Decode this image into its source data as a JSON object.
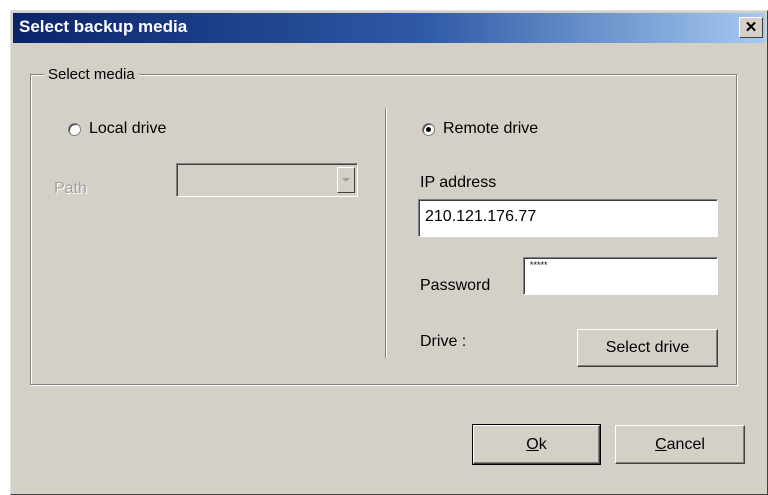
{
  "window": {
    "title": "Select backup media",
    "close_glyph": "✕"
  },
  "group": {
    "label": "Select media"
  },
  "local": {
    "radio_label": "Local drive",
    "selected": false,
    "path_label": "Path",
    "path_value": ""
  },
  "remote": {
    "radio_label": "Remote drive",
    "selected": true,
    "ip_label": "IP address",
    "ip_value": "210.121.176.77",
    "password_label": "Password",
    "password_mask": "*****",
    "drive_label": "Drive :",
    "select_drive_label": "Select drive"
  },
  "buttons": {
    "ok_mnemonic": "O",
    "ok_rest": "k",
    "cancel_mnemonic": "C",
    "cancel_rest": "ancel"
  },
  "icons": {
    "close": "close-icon",
    "dropdown": "chevron-down-icon"
  }
}
